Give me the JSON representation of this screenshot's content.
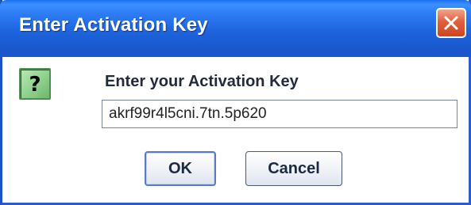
{
  "window": {
    "title": "Enter Activation Key"
  },
  "dialog": {
    "icon": "question-icon",
    "icon_glyph": "?",
    "prompt": "Enter your Activation Key",
    "key_value": "akrf99r4l5cni.7tn.5p620"
  },
  "buttons": {
    "ok_label": "OK",
    "cancel_label": "Cancel"
  },
  "colors": {
    "titlebar": "#1d64dd",
    "close_button": "#e0603d",
    "icon_background": "#8fd08d"
  }
}
